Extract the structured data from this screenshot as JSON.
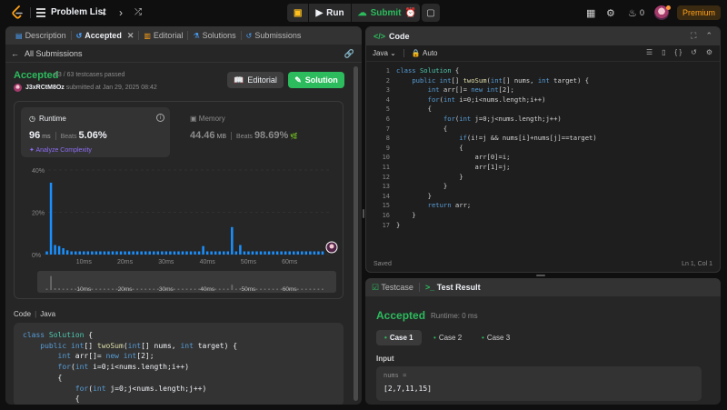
{
  "topbar": {
    "title": "Problem List",
    "run_label": "Run",
    "submit_label": "Submit",
    "fire_count": "0",
    "premium_label": "Premium"
  },
  "left": {
    "tabs": [
      {
        "label": "Description"
      },
      {
        "label": "Accepted"
      },
      {
        "label": "Editorial"
      },
      {
        "label": "Solutions"
      },
      {
        "label": "Submissions"
      }
    ],
    "back_label": "All Submissions",
    "status": "Accepted",
    "testcases": "63 / 63 testcases passed",
    "username": "J3xRCtM8Oz",
    "submitted_text": "submitted at Jan 29, 2025 08:42",
    "editorial_btn": "Editorial",
    "solution_btn": "Solution",
    "runtime": {
      "title": "Runtime",
      "value": "96",
      "unit": "ms",
      "beats_label": "Beats",
      "beats_pct": "5.06%",
      "analyze": "Analyze Complexity"
    },
    "memory": {
      "title": "Memory",
      "value": "44.46",
      "unit": "MB",
      "beats_label": "Beats",
      "beats_pct": "98.69%"
    },
    "code_lang_label": "Code",
    "code_lang": "Java",
    "code_lines": [
      "class Solution {",
      "    public int[] twoSum(int[] nums, int target) {",
      "        int arr[]= new int[2];",
      "        for(int i=0;i<nums.length;i++)",
      "        {",
      "            for(int j=0;j<nums.length;j++)",
      "            {"
    ]
  },
  "chart_data": {
    "type": "bar",
    "title": "",
    "xlabel": "",
    "ylabel": "",
    "ylim": [
      0,
      40
    ],
    "y_ticks": [
      "40%",
      "20%",
      "0%"
    ],
    "x_ticks": [
      "10ms",
      "20ms",
      "30ms",
      "40ms",
      "50ms",
      "60ms"
    ],
    "x_tick_values": [
      10,
      20,
      30,
      40,
      50,
      60
    ],
    "x_range": [
      0,
      70
    ],
    "grid": true,
    "bar_color": "#1a90ff",
    "series": [
      {
        "x": [
          1,
          2,
          3,
          4,
          5,
          6,
          7,
          8,
          9,
          10,
          11,
          12,
          13,
          14,
          15,
          16,
          17,
          18,
          19,
          20,
          21,
          22,
          23,
          24,
          25,
          26,
          27,
          28,
          29,
          30,
          31,
          32,
          33,
          34,
          35,
          36,
          37,
          38,
          39,
          40,
          41,
          42,
          43,
          44,
          45,
          46,
          47,
          48,
          49,
          50,
          51,
          52,
          53,
          54,
          55,
          56,
          57,
          58,
          59,
          60,
          61,
          62,
          63,
          64,
          65,
          66,
          67,
          68
        ],
        "values": [
          1.5,
          34,
          4.5,
          4,
          3,
          2,
          1.5,
          1.5,
          1.5,
          1.5,
          1.5,
          1.5,
          1.5,
          1.5,
          1.5,
          1.5,
          1.5,
          1.5,
          1.5,
          1.5,
          1.5,
          1.5,
          1.5,
          1.5,
          1.5,
          1.5,
          1.5,
          1.5,
          1.5,
          1.5,
          1.5,
          1.5,
          1.5,
          1.5,
          1.5,
          1.5,
          1.5,
          1.5,
          4,
          1.5,
          1.5,
          1.5,
          1.5,
          1.5,
          1.5,
          13,
          1.5,
          4.5,
          1.5,
          1.5,
          1.5,
          1.5,
          1.5,
          1.5,
          1.5,
          1.5,
          1.5,
          1.5,
          1.5,
          1.5,
          1.5,
          1.5,
          1.5,
          1.5,
          1.5,
          1.5,
          1.5,
          1.5
        ]
      }
    ]
  },
  "editor": {
    "title": "Code",
    "language": "Java",
    "auto_label": "Auto",
    "footer_left": "Saved",
    "footer_right": "Ln 1, Col 1",
    "lines": [
      "1",
      "2",
      "3",
      "4",
      "5",
      "6",
      "7",
      "8",
      "9",
      "10",
      "11",
      "12",
      "13",
      "14",
      "15",
      "16",
      "17"
    ]
  },
  "result": {
    "tab_testcase": "Testcase",
    "tab_result": "Test Result",
    "status": "Accepted",
    "runtime": "Runtime: 0 ms",
    "cases": [
      "Case 1",
      "Case 2",
      "Case 3"
    ],
    "input_label": "Input",
    "input_var": "nums =",
    "input_val": "[2,7,11,15]"
  }
}
